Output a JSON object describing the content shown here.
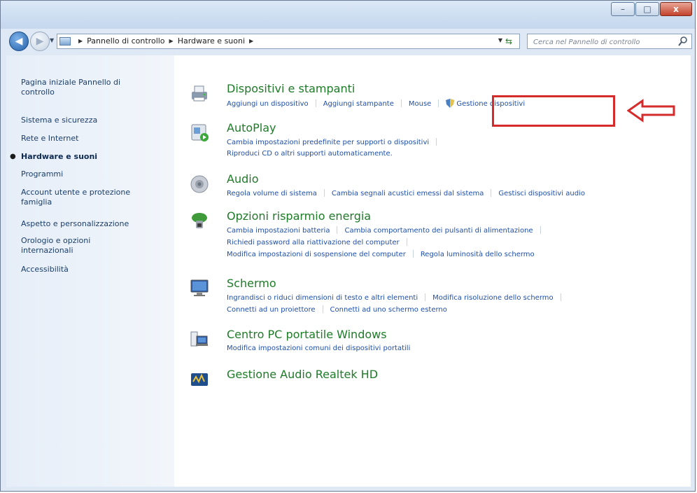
{
  "breadcrumb": {
    "items": [
      "Pannello di controllo",
      "Hardware e suoni"
    ]
  },
  "search": {
    "placeholder": "Cerca nel Pannello di controllo"
  },
  "window_buttons": {
    "minimize": "–",
    "maximize": "□",
    "close": "x"
  },
  "sidebar": {
    "home": "Pagina iniziale Pannello di controllo",
    "items": [
      {
        "label": "Sistema e sicurezza",
        "active": false
      },
      {
        "label": "Rete e Internet",
        "active": false
      },
      {
        "label": "Hardware e suoni",
        "active": true
      },
      {
        "label": "Programmi",
        "active": false
      },
      {
        "label": "Account utente e protezione famiglia",
        "active": false
      },
      {
        "label": "Aspetto e personalizzazione",
        "active": false
      },
      {
        "label": "Orologio e opzioni internazionali",
        "active": false
      },
      {
        "label": "Accessibilità",
        "active": false
      }
    ]
  },
  "categories": [
    {
      "title": "Dispositivi e stampanti",
      "icon": "printer-icon",
      "rows": [
        [
          "Aggiungi un dispositivo",
          "Aggiungi stampante",
          "Mouse",
          "Gestione dispositivi"
        ]
      ]
    },
    {
      "title": "AutoPlay",
      "icon": "autoplay-icon",
      "rows": [
        [
          "Cambia impostazioni predefinite per supporti o dispositivi"
        ],
        [
          "Riproduci CD o altri supporti automaticamente."
        ]
      ]
    },
    {
      "title": "Audio",
      "icon": "speaker-icon",
      "rows": [
        [
          "Regola volume di sistema",
          "Cambia segnali acustici emessi dal sistema",
          "Gestisci dispositivi audio"
        ]
      ]
    },
    {
      "title": "Opzioni risparmio energia",
      "icon": "power-options-icon",
      "rows": [
        [
          "Cambia impostazioni batteria",
          "Cambia comportamento dei pulsanti di alimentazione"
        ],
        [
          "Richiedi password alla riattivazione del computer"
        ],
        [
          "Modifica impostazioni di sospensione del computer",
          "Regola luminosità dello schermo"
        ]
      ]
    },
    {
      "title": "Schermo",
      "icon": "monitor-icon",
      "rows": [
        [
          "Ingrandisci o riduci dimensioni di testo e altri elementi",
          "Modifica risoluzione dello schermo"
        ],
        [
          "Connetti ad un proiettore",
          "Connetti ad uno schermo esterno"
        ]
      ]
    },
    {
      "title": "Centro PC portatile Windows",
      "icon": "mobility-center-icon",
      "rows": [
        [
          "Modifica impostazioni comuni dei dispositivi portatili"
        ]
      ]
    },
    {
      "title": "Gestione Audio Realtek HD",
      "icon": "realtek-icon",
      "rows": []
    }
  ],
  "annotation": {
    "color": "#d52b2b",
    "highlighted_link": "Gestione dispositivi"
  }
}
